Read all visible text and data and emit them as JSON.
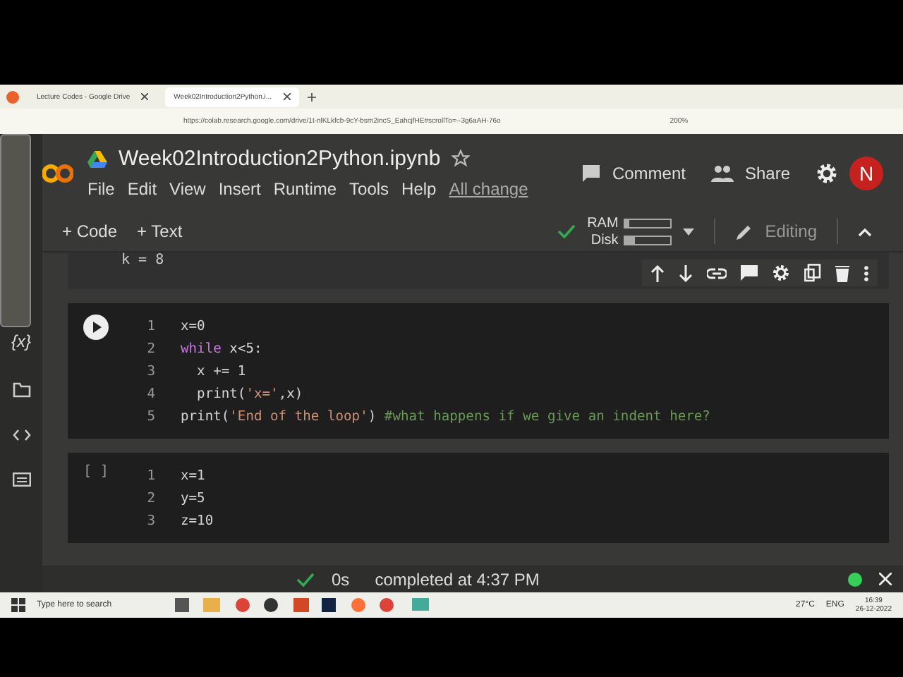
{
  "browser": {
    "tabs": [
      {
        "title": "Lecture Codes - Google Drive",
        "selected": false
      },
      {
        "title": "Week02Introduction2Python.i...",
        "selected": true
      }
    ],
    "url": "https://colab.research.google.com/drive/1t-nlKLkfcb-9cY-bsm2incS_EahcjfHE#scrollTo=--3g6aAH-76o",
    "zoom": "200%"
  },
  "notebook": {
    "title": "Week02Introduction2Python.ipynb",
    "menu": [
      "File",
      "Edit",
      "View",
      "Insert",
      "Runtime",
      "Tools",
      "Help"
    ],
    "save_status": "All change",
    "comment": "Comment",
    "share": "Share",
    "avatar": "N"
  },
  "toolbar": {
    "add_code": "+ Code",
    "add_text": "+ Text",
    "ram_label": "RAM",
    "ram": {
      "level": 0.1
    },
    "disk_label": "Disk",
    "disk": {
      "level": 0.2
    },
    "mode": "Editing"
  },
  "previous_output": "k = 8",
  "sidebar": {
    "variables_label": "{x}"
  },
  "cells": [
    {
      "kind": "run",
      "lines": [
        {
          "number": "1",
          "tokens": [
            {
              "kind": "plain",
              "text": "x=0"
            }
          ]
        },
        {
          "number": "2",
          "tokens": [
            {
              "kind": "keyword",
              "text": "while"
            },
            {
              "kind": "plain",
              "text": " x<5:"
            }
          ]
        },
        {
          "number": "3",
          "tokens": [
            {
              "kind": "plain",
              "text": "  x += 1"
            }
          ]
        },
        {
          "number": "4",
          "tokens": [
            {
              "kind": "plain",
              "text": "  print("
            },
            {
              "kind": "string",
              "text": "'x='"
            },
            {
              "kind": "plain",
              "text": ",x)"
            }
          ]
        },
        {
          "number": "5",
          "tokens": [
            {
              "kind": "plain",
              "text": "print("
            },
            {
              "kind": "string",
              "text": "'End of the loop'"
            },
            {
              "kind": "plain",
              "text": ") "
            },
            {
              "kind": "comment",
              "text": "#what happens if we give an indent here?"
            }
          ]
        }
      ]
    },
    {
      "kind": "idle",
      "prompt": "[ ]",
      "lines": [
        {
          "number": "1",
          "tokens": [
            {
              "kind": "plain",
              "text": "x=1"
            }
          ]
        },
        {
          "number": "2",
          "tokens": [
            {
              "kind": "plain",
              "text": "y=5"
            }
          ]
        },
        {
          "number": "3",
          "tokens": [
            {
              "kind": "plain",
              "text": "z=10"
            }
          ]
        }
      ]
    }
  ],
  "status_bar": {
    "duration": "0s",
    "message": "completed at 4:37 PM"
  },
  "taskbar": {
    "search_placeholder": "Type here to search",
    "weather": "27°C",
    "language": "ENG",
    "time": "16:39",
    "date": "26-12-2022"
  }
}
